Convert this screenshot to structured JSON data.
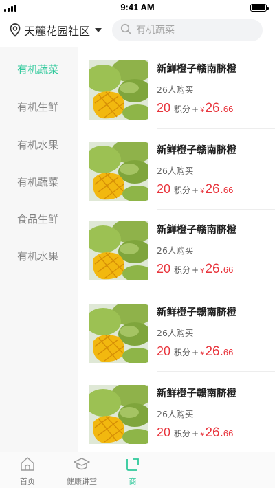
{
  "status_bar": {
    "time": "9:41 AM"
  },
  "header": {
    "location": "天麓花园社区",
    "search_placeholder": "有机蔬菜",
    "icons": {
      "location": "location-pin-icon",
      "dropdown": "caret-down-icon",
      "search": "search-icon"
    }
  },
  "sidebar": {
    "categories": [
      {
        "label": "有机蔬菜",
        "active": true
      },
      {
        "label": "有机生鲜",
        "active": false
      },
      {
        "label": "有机水果",
        "active": false
      },
      {
        "label": "有机蔬菜",
        "active": false
      },
      {
        "label": "食品生鲜",
        "active": false
      },
      {
        "label": "有机水果",
        "active": false
      }
    ]
  },
  "products": [
    {
      "title": "新鲜橙子赣南脐橙",
      "sales": "26人购买",
      "points": "20",
      "points_label": "积分",
      "plus": "+",
      "currency": "¥",
      "price_int": "26.",
      "price_dec": "66"
    },
    {
      "title": "新鲜橙子赣南脐橙",
      "sales": "26人购买",
      "points": "20",
      "points_label": "积分",
      "plus": "+",
      "currency": "¥",
      "price_int": "26.",
      "price_dec": "66"
    },
    {
      "title": "新鲜橙子赣南脐橙",
      "sales": "26人购买",
      "points": "20",
      "points_label": "积分",
      "plus": "+",
      "currency": "¥",
      "price_int": "26.",
      "price_dec": "66"
    },
    {
      "title": "新鲜橙子赣南脐橙",
      "sales": "26人购买",
      "points": "20",
      "points_label": "积分",
      "plus": "+",
      "currency": "¥",
      "price_int": "26.",
      "price_dec": "66"
    },
    {
      "title": "新鲜橙子赣南脐橙",
      "sales": "26人购买",
      "points": "20",
      "points_label": "积分",
      "plus": "+",
      "currency": "¥",
      "price_int": "26.",
      "price_dec": "66"
    }
  ],
  "tabbar": {
    "tabs": [
      {
        "label": "首页",
        "icon": "home-icon",
        "active": false
      },
      {
        "label": "健康讲堂",
        "icon": "graduation-cap-icon",
        "active": false
      },
      {
        "label": "商",
        "icon": "shop-icon",
        "active": true
      }
    ]
  },
  "colors": {
    "accent": "#2fc99b",
    "price": "#e8343c",
    "sidebar_bg": "#f7f7f7",
    "text_muted": "#808080"
  }
}
